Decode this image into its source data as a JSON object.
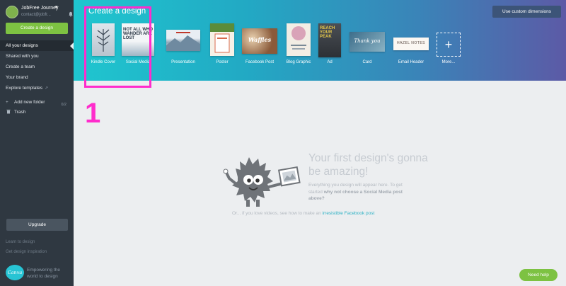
{
  "user": {
    "name": "JobFree Journey",
    "email": "contact@jobfr..."
  },
  "sidebar": {
    "create_button": "Create a design",
    "nav": [
      {
        "label": "All your designs",
        "active": true
      },
      {
        "label": "Shared with you"
      },
      {
        "label": "Create a team"
      },
      {
        "label": "Your brand"
      },
      {
        "label": "Explore templates",
        "external": "↗"
      }
    ],
    "folder": {
      "label": "Add new folder",
      "count": "0/2"
    },
    "trash": {
      "label": "Trash"
    },
    "upgrade": "Upgrade",
    "learn": "Learn to design",
    "inspiration": "Get design inspiration",
    "logo": "Canva",
    "tagline": "Empowering the world to design"
  },
  "banner": {
    "title": "Create a design",
    "custom_dimensions": "Use custom dimensions",
    "templates": [
      {
        "label": "Kindle Cover",
        "thumb_text": ""
      },
      {
        "label": "Social Media",
        "thumb_text": "NOT ALL WHO WANDER ARE LOST"
      },
      {
        "label": "Presentation",
        "thumb_text": ""
      },
      {
        "label": "Poster",
        "thumb_text": ""
      },
      {
        "label": "Facebook Post",
        "thumb_text": "Waffles"
      },
      {
        "label": "Blog Graphic",
        "thumb_text": ""
      },
      {
        "label": "Ad",
        "thumb_text": "REACH YOUR PEAK"
      },
      {
        "label": "Card",
        "thumb_text": "Thank you"
      },
      {
        "label": "Email Header",
        "thumb_text": "HAZEL NOTES"
      },
      {
        "label": "More...",
        "thumb_text": "+"
      }
    ],
    "accent": "#22a9c4"
  },
  "annotation": {
    "step": "1",
    "color": "#ff2ccc"
  },
  "empty_state": {
    "title": "Your first design's gonna be amazing!",
    "desc_start": "Everything you design will appear here. To get started ",
    "desc_bold": "why not choose a Social Media post above?",
    "video_text": "Or... if you love videos, see how to make an ",
    "video_link": "irresistible Facebook post"
  },
  "help": "Need help"
}
